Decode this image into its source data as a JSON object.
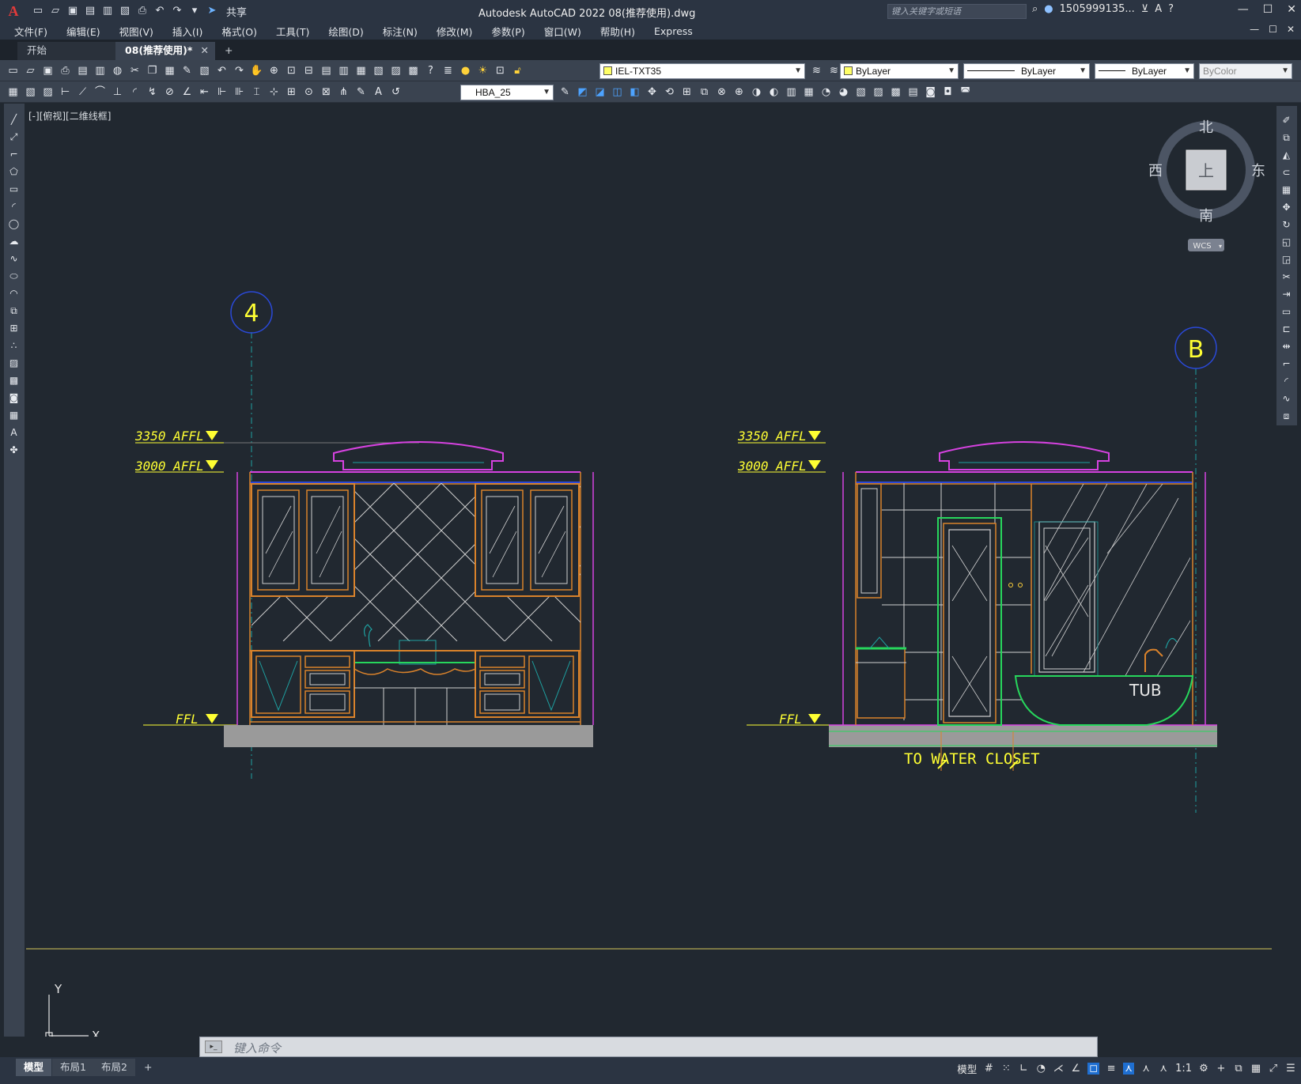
{
  "app": {
    "logo_letter": "A",
    "title": "Autodesk AutoCAD 2022    08(推荐使用).dwg",
    "share_label": "共享",
    "search_placeholder": "键入关键字或短语",
    "user_name": "1505999135...",
    "win_min": "—",
    "win_max": "☐",
    "win_close": "✕"
  },
  "menu": [
    "文件(F)",
    "编辑(E)",
    "视图(V)",
    "插入(I)",
    "格式(O)",
    "工具(T)",
    "绘图(D)",
    "标注(N)",
    "修改(M)",
    "参数(P)",
    "窗口(W)",
    "帮助(H)",
    "Express"
  ],
  "tabs": {
    "start_label": "开始",
    "doc_label": "08(推荐使用)*",
    "close_glyph": "✕",
    "add_glyph": "+"
  },
  "toolbar": {
    "layer_name": "IEL-TXT35",
    "color": "ByLayer",
    "linetype": "ByLayer",
    "lineweight": "ByLayer",
    "plotstyle": "ByColor",
    "dimstyle": "HBA_25"
  },
  "viewport": {
    "label": "[-][俯视][二维线框]"
  },
  "viewcube": {
    "north": "北",
    "south": "南",
    "east": "东",
    "west": "西",
    "face": "上",
    "wcs": "WCS"
  },
  "drawing": {
    "grid_left": "4",
    "grid_right": "B",
    "level_3350": "3350 AFFL",
    "level_3000": "3000 AFFL",
    "level_ffl": "FFL",
    "tub_label": "TUB",
    "water_closet": "TO WATER CLOSET"
  },
  "ucs": {
    "x": "X",
    "y": "Y"
  },
  "command": {
    "placeholder": "键入命令"
  },
  "layout_tabs": [
    "模型",
    "布局1",
    "布局2"
  ],
  "layout_add": "+",
  "status": {
    "model_label": "模型",
    "scale": "1:1"
  },
  "colors": {
    "background": "#212830",
    "yellow": "#ffff33",
    "orange": "#d9822b",
    "magenta": "#d642e0",
    "green": "#27d65c",
    "blue_grid": "#2a49d8",
    "cyan_line": "#1ea0a0"
  }
}
